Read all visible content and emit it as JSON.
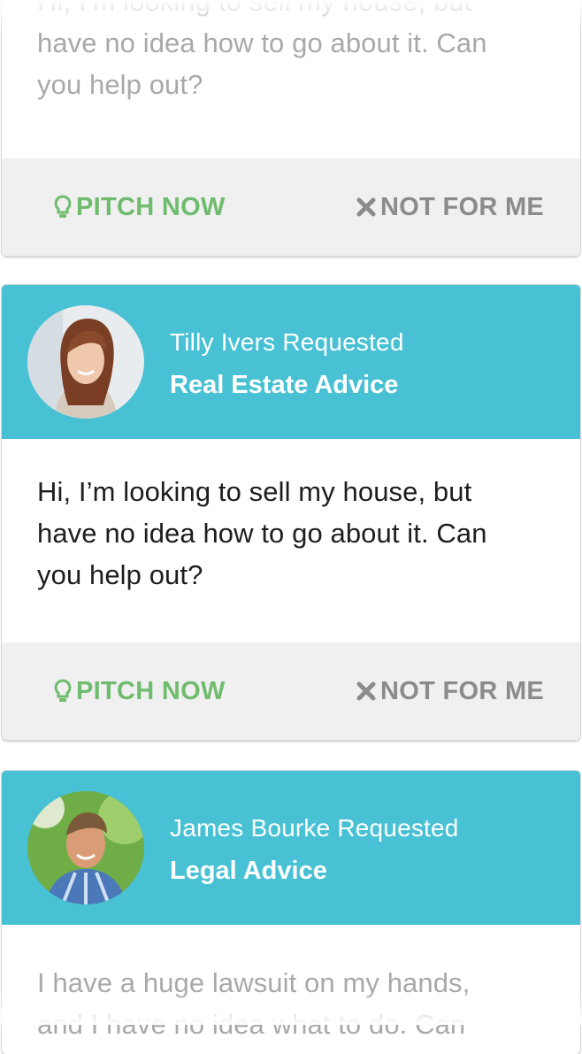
{
  "colors": {
    "accent": "#47c1d3",
    "pitch_green": "#6fbc6e",
    "dismiss_gray": "#8b8b8b",
    "action_bar": "#f0f0f0"
  },
  "actions": {
    "pitch_label": "PITCH NOW",
    "pitch_icon": "lightbulb-icon",
    "dismiss_label": "NOT FOR ME",
    "dismiss_icon": "close-x-icon"
  },
  "requests": [
    {
      "message_lines": [
        "Hi, I’m looking to sell my house, but",
        "have no idea how to go about it. Can",
        "you help out?"
      ]
    },
    {
      "requester": "Tilly Ivers Requested",
      "topic": "Real Estate Advice",
      "message_lines": [
        "Hi, I’m looking to sell my house, but",
        "have no idea how to go about it. Can",
        "you help out?"
      ]
    },
    {
      "requester": "James Bourke Requested",
      "topic": "Legal Advice",
      "message_lines": [
        "I have a huge lawsuit on my hands,",
        "and I have no idea what to do. Can"
      ]
    }
  ]
}
